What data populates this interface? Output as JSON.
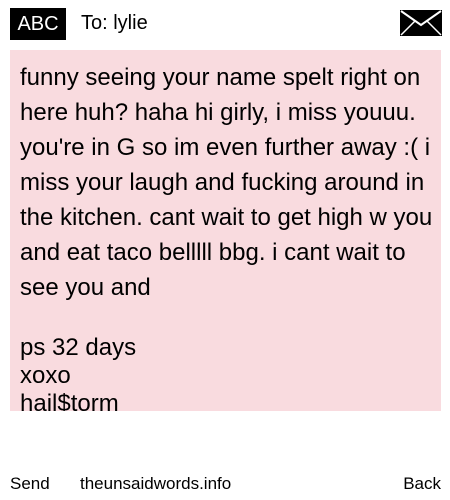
{
  "header": {
    "badge": "ABC",
    "to": "To: lylie",
    "mail_icon": "envelope-icon"
  },
  "message": {
    "body": "funny seeing your name spelt right on here huh? haha hi girly, i miss youuu. you're in G so im even further away :( i miss your laugh and fucking around in the kitchen. cant wait to get high w you and eat taco belllll bbg. i cant wait to see you and",
    "ps_lines": [
      "ps 32 days",
      "xoxo",
      "hail$torm"
    ]
  },
  "footer": {
    "send": "Send",
    "site": "theunsaidwords.info",
    "back": "Back"
  },
  "colors": {
    "message_background": "#f9dbdf",
    "badge_background": "#000000"
  }
}
